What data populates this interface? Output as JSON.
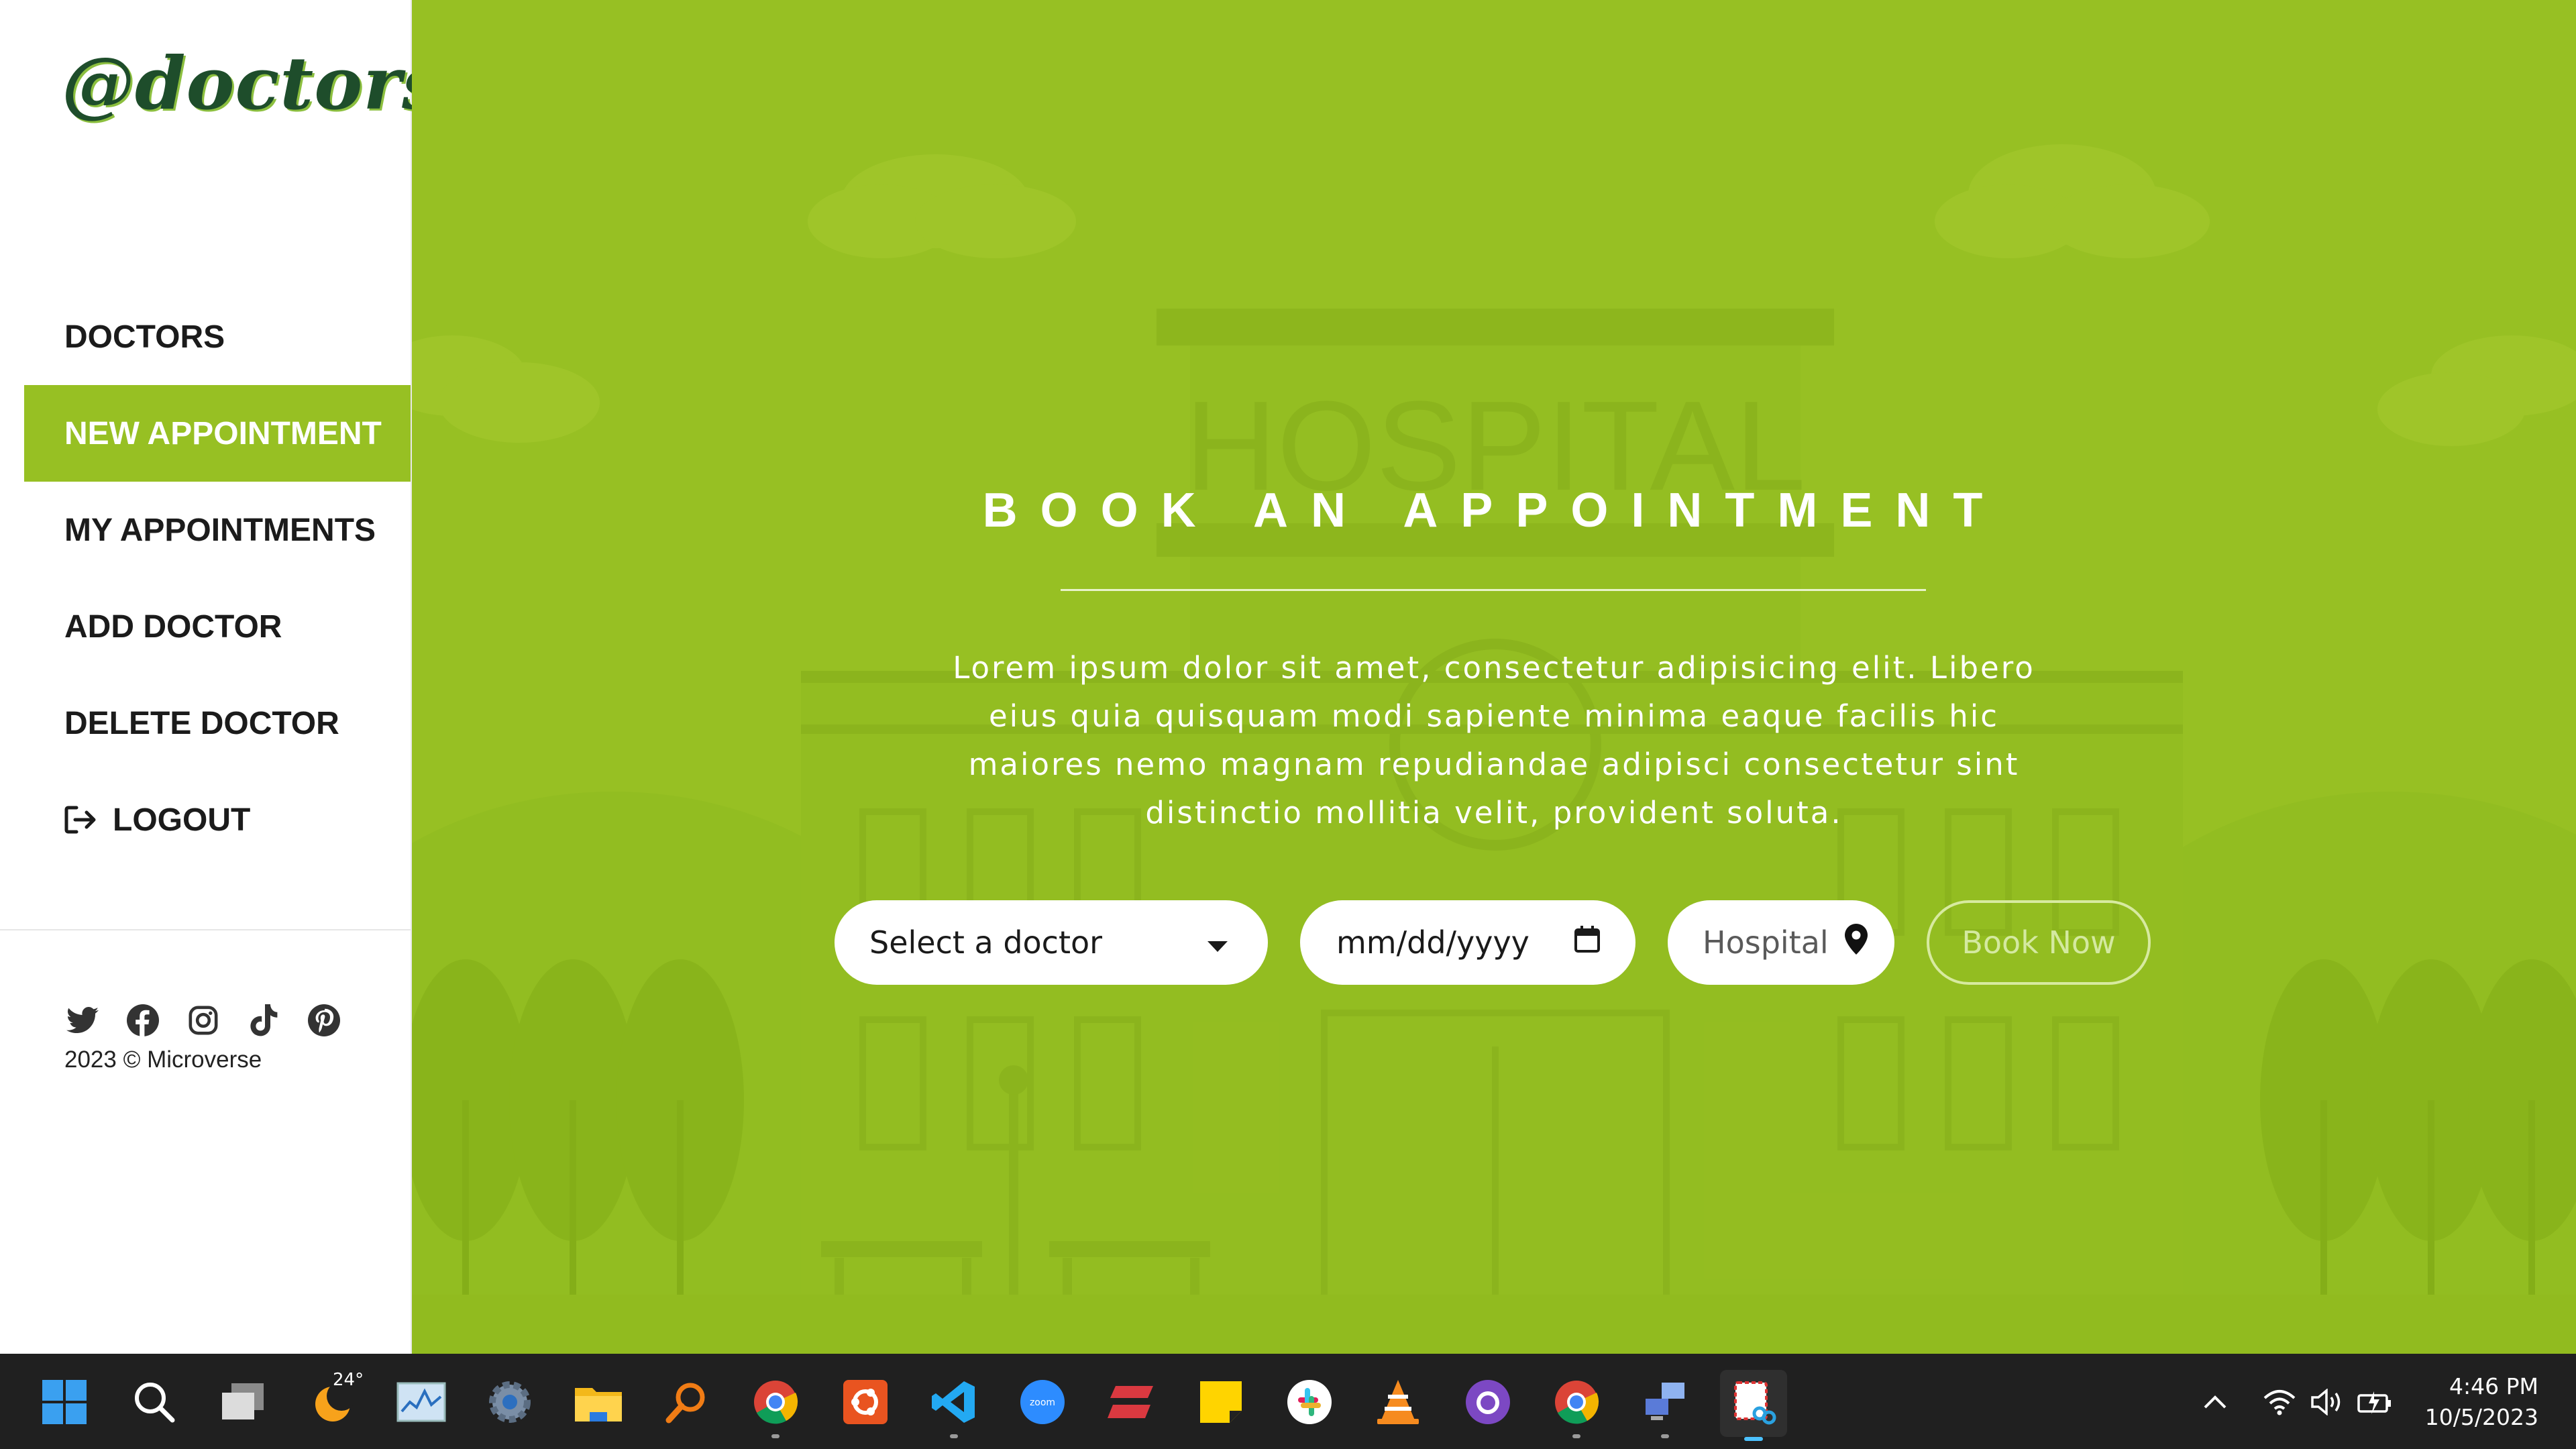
{
  "sidebar": {
    "logo": "@doctors",
    "nav": [
      {
        "label": "DOCTORS",
        "active": false
      },
      {
        "label": "NEW APPOINTMENT",
        "active": true
      },
      {
        "label": "MY APPOINTMENTS",
        "active": false
      },
      {
        "label": "ADD DOCTOR",
        "active": false
      },
      {
        "label": "DELETE DOCTOR",
        "active": false
      },
      {
        "label": "LOGOUT",
        "active": false,
        "icon": "logout-icon"
      }
    ],
    "social_icons": [
      "twitter-icon",
      "facebook-icon",
      "instagram-icon",
      "tiktok-icon",
      "pinterest-icon"
    ],
    "copyright": "2023 © Microverse"
  },
  "main": {
    "background_image_text": "HOSPITAL",
    "heading": "BOOK AN APPOINTMENT",
    "description": "Lorem ipsum dolor sit amet, consectetur adipisicing elit. Libero eius quia quisquam modi sapiente minima eaque facilis hic maiores nemo magnam repudiandae adipisci consectetur sint distinctio mollitia velit, provident soluta.",
    "form": {
      "doctor_select": "Select a doctor",
      "date_placeholder": "mm/dd/yyyy",
      "hospital_placeholder": "Hospital",
      "book_button": "Book Now"
    }
  },
  "taskbar": {
    "weather_temp": "24°",
    "clock_time": "4:46 PM",
    "clock_date": "10/5/2023",
    "apps": [
      "start-icon",
      "search-icon",
      "task-view-icon",
      "weather-icon",
      "task-manager-icon",
      "settings-icon",
      "file-explorer-icon",
      "search-tool-icon",
      "chrome-icon",
      "ubuntu-icon",
      "vscode-icon",
      "zoom-icon",
      "express-vpn-icon",
      "sticky-notes-icon",
      "slack-icon",
      "vlc-icon",
      "github-desktop-icon",
      "chrome-profile-icon",
      "remote-desktop-icon",
      "snipping-tool-icon"
    ]
  },
  "colors": {
    "accent": "#97c023",
    "logo_text": "#1e4d2b",
    "taskbar": "#202020"
  }
}
